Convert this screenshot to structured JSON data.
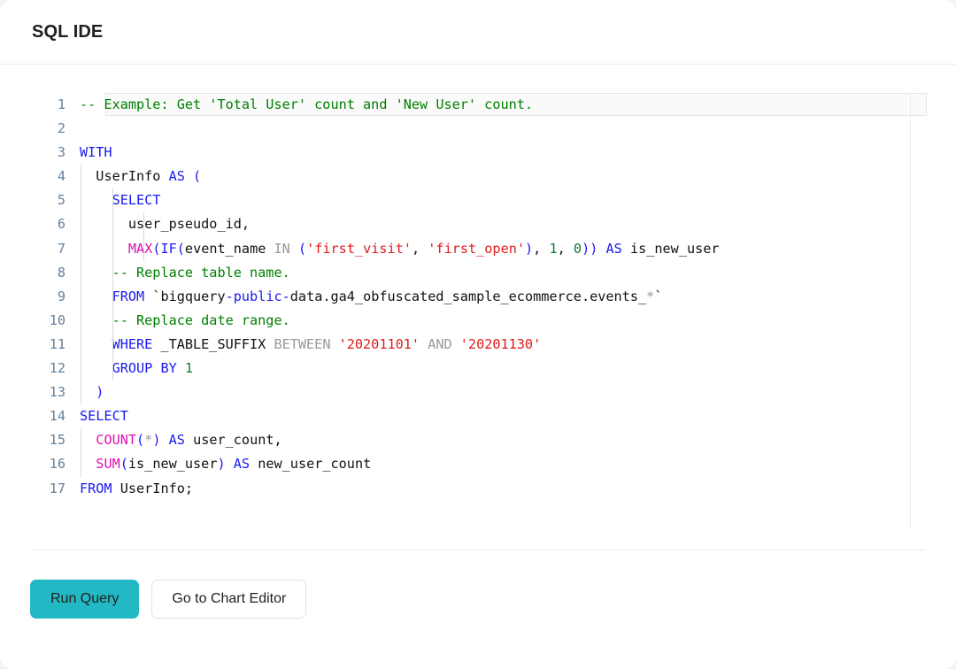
{
  "header": {
    "title": "SQL IDE"
  },
  "editor": {
    "language": "sql",
    "active_line": 1,
    "total_lines": 17,
    "line_numbers": [
      "1",
      "2",
      "3",
      "4",
      "5",
      "6",
      "7",
      "8",
      "9",
      "10",
      "11",
      "12",
      "13",
      "14",
      "15",
      "16",
      "17"
    ],
    "lines": [
      {
        "n": "1",
        "text": "-- Example: Get 'Total User' count and 'New User' count."
      },
      {
        "n": "2",
        "text": ""
      },
      {
        "n": "3",
        "text": "WITH"
      },
      {
        "n": "4",
        "text": "  UserInfo AS ("
      },
      {
        "n": "5",
        "text": "    SELECT"
      },
      {
        "n": "6",
        "text": "      user_pseudo_id,"
      },
      {
        "n": "7",
        "text": "      MAX(IF(event_name IN ('first_visit', 'first_open'), 1, 0)) AS is_new_user"
      },
      {
        "n": "8",
        "text": "    -- Replace table name."
      },
      {
        "n": "9",
        "text": "    FROM `bigquery-public-data.ga4_obfuscated_sample_ecommerce.events_*`"
      },
      {
        "n": "10",
        "text": "    -- Replace date range."
      },
      {
        "n": "11",
        "text": "    WHERE _TABLE_SUFFIX BETWEEN '20201101' AND '20201130'"
      },
      {
        "n": "12",
        "text": "    GROUP BY 1"
      },
      {
        "n": "13",
        "text": "  )"
      },
      {
        "n": "14",
        "text": "SELECT"
      },
      {
        "n": "15",
        "text": "  COUNT(*) AS user_count,"
      },
      {
        "n": "16",
        "text": "  SUM(is_new_user) AS new_user_count"
      },
      {
        "n": "17",
        "text": "FROM UserInfo;"
      }
    ],
    "tokens": {
      "l1_comment": "-- Example: Get 'Total User' count and 'New User' count.",
      "l3_with": "WITH",
      "l4_name": "UserInfo ",
      "l4_as": "AS",
      "l4_paren": " (",
      "l5_select": "SELECT",
      "l6_col": "user_pseudo_id,",
      "l7_max": "MAX",
      "l7_lp": "(",
      "l7_if": "IF",
      "l7_lp2": "(",
      "l7_eventname": "event_name ",
      "l7_in": "IN",
      "l7_lp3": " (",
      "l7_s1": "'first_visit'",
      "l7_comma1": ", ",
      "l7_s2": "'first_open'",
      "l7_rp": ")",
      "l7_comma2": ", ",
      "l7_n1": "1",
      "l7_comma3": ", ",
      "l7_n0": "0",
      "l7_rp2": "))",
      "l7_as": " AS",
      "l7_alias": " is_new_user",
      "l8_comment": "-- Replace table name.",
      "l9_from": "FROM",
      "l9_tick_open": " `bigquery",
      "l9_dash1": "-",
      "l9_public": "public",
      "l9_dash2": "-",
      "l9_rest": "data.ga4_obfuscated_sample_ecommerce.events_",
      "l9_star": "*",
      "l9_tick_close": "`",
      "l10_comment": "-- Replace date range.",
      "l11_where": "WHERE",
      "l11_suffix": " _TABLE_SUFFIX ",
      "l11_between": "BETWEEN",
      "l11_d1": " '20201101' ",
      "l11_and": "AND",
      "l11_d2": " '20201130'",
      "l12_groupby": "GROUP BY",
      "l12_one": " 1",
      "l13_rp": ")",
      "l14_select": "SELECT",
      "l15_count": "COUNT",
      "l15_lp": "(",
      "l15_star": "*",
      "l15_rp": ")",
      "l15_as": " AS",
      "l15_alias": " user_count,",
      "l16_sum": "SUM",
      "l16_lp": "(",
      "l16_arg": "is_new_user",
      "l16_rp": ")",
      "l16_as": " AS",
      "l16_alias": " new_user_count",
      "l17_from": "FROM",
      "l17_rest": " UserInfo;"
    }
  },
  "footer": {
    "run_query_label": "Run Query",
    "chart_editor_label": "Go to Chart Editor"
  },
  "colors": {
    "accent": "#22b8c4",
    "keyword": "#1a1aee",
    "function": "#e010b0",
    "comment": "#008000",
    "string": "#e01b1b",
    "number": "#117733",
    "secondary_keyword": "#999999",
    "gutter": "#4a6b8a",
    "border": "#ececec",
    "page_bg": "#f1f3f4"
  }
}
